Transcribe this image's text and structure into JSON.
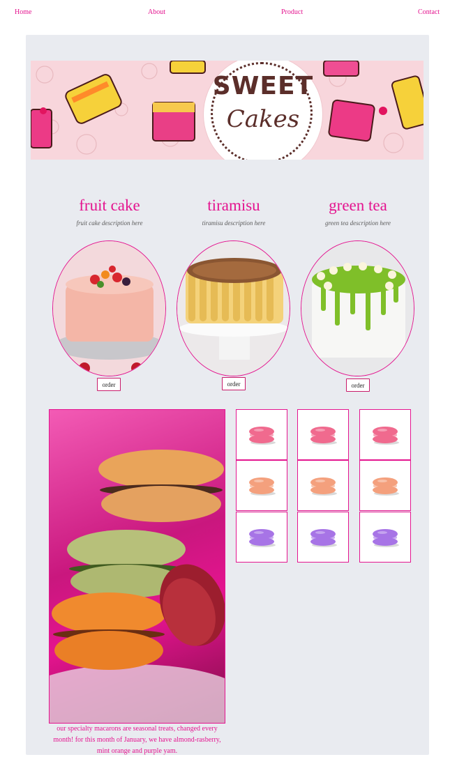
{
  "nav": {
    "home": "Home",
    "about": "About",
    "product": "Product",
    "contact": "Contact"
  },
  "banner": {
    "line1": "SWEET",
    "line2": "Cakes"
  },
  "products": [
    {
      "title": "fruit cake",
      "desc": "fruit cake description here",
      "button": "order"
    },
    {
      "title": "tiramisu",
      "desc": "tiramisu description here",
      "button": "order"
    },
    {
      "title": "green tea",
      "desc": "green tea description here",
      "button": "order"
    }
  ],
  "macarons": {
    "caption": "our specialty macarons are seasonal treats, changed every month! for this month of January, we have almond-rasberry, mint orange and purple yam.",
    "rows": [
      {
        "color": "#f06a8e"
      },
      {
        "color": "#f4a07d"
      },
      {
        "color": "#a774e6"
      }
    ]
  },
  "colors": {
    "accent": "#e4148f",
    "panel": "#e9ebf0"
  }
}
